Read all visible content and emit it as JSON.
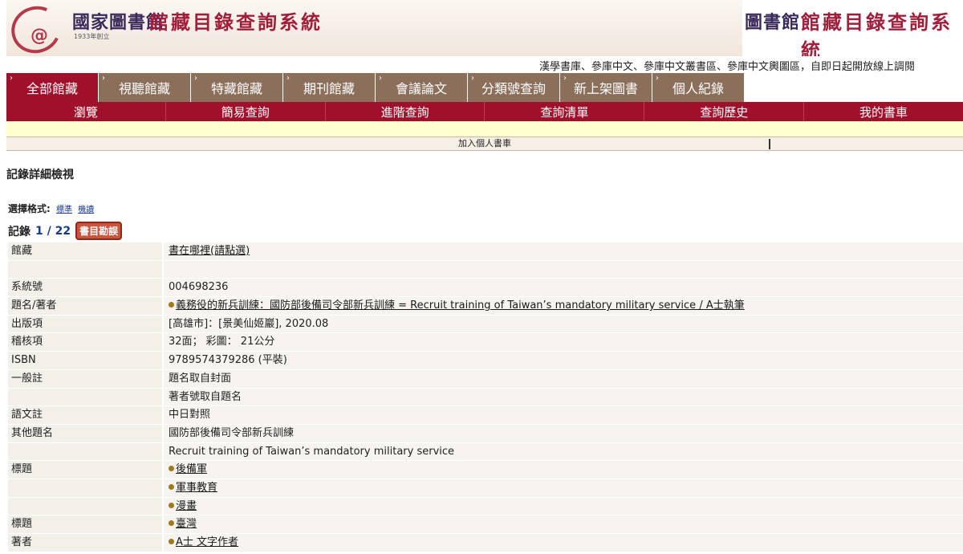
{
  "header": {
    "library_name": "國家圖書館",
    "library_sub": "1933年創立",
    "system_name": "館藏目錄查詢系統",
    "library_name_right": "圖書館",
    "system_name_right": "館藏目錄查詢系統"
  },
  "notice": "漢學書庫、參庫中文、參庫中文叢書區、參庫中文輿圖區，自即日起開放線上調閱",
  "tabs": [
    {
      "label": "全部館藏"
    },
    {
      "label": "視聽館藏"
    },
    {
      "label": "特藏館藏"
    },
    {
      "label": "期刊館藏"
    },
    {
      "label": "會議論文"
    },
    {
      "label": "分類號查詢"
    },
    {
      "label": "新上架圖書"
    },
    {
      "label": "個人紀錄"
    }
  ],
  "subnav": [
    "瀏覽",
    "簡易查詢",
    "進階查詢",
    "查詢清單",
    "查詢歷史",
    "我的書車"
  ],
  "add_to_cart": "加入個人書車",
  "detail_title": "記錄詳細檢視",
  "format": {
    "label": "選擇格式:",
    "standard": "標準",
    "marc": "機讀"
  },
  "record": {
    "label": "記錄",
    "position": "1 / 22",
    "errata": "書目勘誤"
  },
  "rows": [
    {
      "label": "館藏",
      "value": "書在哪裡(請點選)",
      "link": true,
      "bullet": false
    },
    {
      "label": "",
      "value": "",
      "link": false,
      "bullet": false
    },
    {
      "label": "系統號",
      "value": "004698236",
      "link": false,
      "bullet": false
    },
    {
      "label": "題名/著者",
      "value": "義務役的新兵訓練：國防部後備司令部新兵訓練 = Recruit training of Taiwan’s mandatory military service / A士執筆",
      "link": true,
      "bullet": true
    },
    {
      "label": "出版項",
      "value": "[高雄市]：[景美仙姬巖], 2020.08",
      "link": false,
      "bullet": false
    },
    {
      "label": "稽核項",
      "value": "32面； 彩圖： 21公分",
      "link": false,
      "bullet": false
    },
    {
      "label": "ISBN",
      "value": "9789574379286 (平裝)",
      "link": false,
      "bullet": false
    },
    {
      "label": "一般註",
      "value": "題名取自封面",
      "link": false,
      "bullet": false
    },
    {
      "label": "",
      "value": "著者號取自題名",
      "link": false,
      "bullet": false
    },
    {
      "label": "語文註",
      "value": "中日對照",
      "link": false,
      "bullet": false
    },
    {
      "label": "其他題名",
      "value": "國防部後備司令部新兵訓練",
      "link": false,
      "bullet": false
    },
    {
      "label": "",
      "value": "Recruit training of Taiwan’s mandatory military service",
      "link": false,
      "bullet": false
    },
    {
      "label": "標題",
      "value": "後備軍",
      "link": true,
      "bullet": true
    },
    {
      "label": "",
      "value": "軍事教育",
      "link": true,
      "bullet": true
    },
    {
      "label": "",
      "value": "漫畫",
      "link": true,
      "bullet": true
    },
    {
      "label": "標題",
      "value": "臺灣",
      "link": true,
      "bullet": true
    },
    {
      "label": "著者",
      "value": "A士 文字作者",
      "link": true,
      "bullet": true
    }
  ],
  "colors": {
    "brand_red": "#a0102a",
    "tab_brown": "#8b6f5a",
    "highlight_yellow": "#ffffd0"
  }
}
